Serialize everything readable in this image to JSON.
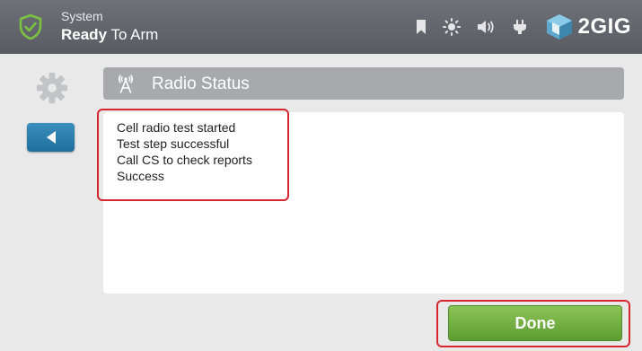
{
  "header": {
    "system_label": "System",
    "status_bold": "Ready",
    "status_rest": " To Arm",
    "brand_text": "2GIG",
    "status_icons": [
      "bookmark-icon",
      "sun-icon",
      "speaker-icon",
      "power-plug-icon"
    ]
  },
  "sidebar": {
    "settings_icon": "gear-icon",
    "back_icon": "arrow-left-icon"
  },
  "panel": {
    "title": "Radio Status",
    "title_icon": "radio-tower-icon",
    "messages": [
      "Cell radio test started",
      "Test step successful",
      "Call CS to check reports",
      "Success"
    ]
  },
  "footer": {
    "done_label": "Done"
  },
  "colors": {
    "top_bar": "#5f6169",
    "accent_green": "#6dae3d",
    "back_blue": "#2a7fae",
    "highlight_red": "#d6262e",
    "shield_green": "#7cc242"
  }
}
